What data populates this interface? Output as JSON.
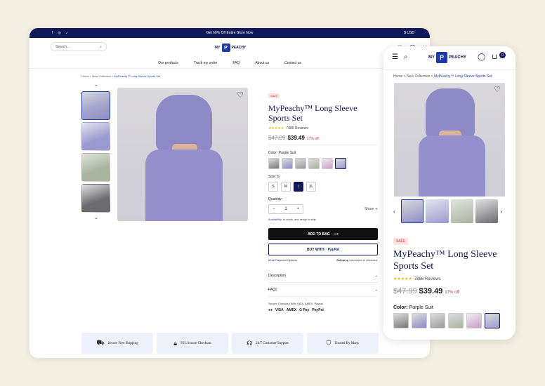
{
  "desktop": {
    "announcement": "Get 60% Off Entire Store Now",
    "currency": "$ USD",
    "socials": [
      "facebook-icon",
      "instagram-icon",
      "tiktok-icon"
    ],
    "search_placeholder": "Search...",
    "logo_left": "MY",
    "logo_mark": "P",
    "logo_right": "PEACHY",
    "nav": [
      "Our products",
      "Track my order",
      "FAQ",
      "About us",
      "Contact us"
    ],
    "breadcrumb": {
      "home": "Home",
      "sep": ">",
      "collection": "New Collection",
      "current": "MyPeachy™ Long Sleeve Sports Set"
    },
    "product": {
      "badge": "SALE",
      "title": "MyPeachy™ Long Sleeve Sports Set",
      "stars": "★★★★★",
      "reviews": "7886 Reviews",
      "old_price": "$47.99",
      "new_price": "$39.49",
      "discount": "17% off",
      "color_label": "Color: Purple Suit",
      "size_label": "Size: S",
      "sizes": [
        "S",
        "M",
        "L",
        "XL"
      ],
      "selected_size": "L",
      "qty_label": "Quantity:",
      "qty": "1",
      "minus": "−",
      "plus": "+",
      "share": "Share",
      "availability_label": "Availability:",
      "availability": "In stock, and ready to ship",
      "add_to_bag": "ADD TO BAG",
      "buy_with": "BUY WITH",
      "paypal": "PayPal",
      "more_payment": "More Payment Options",
      "shipping_bold": "Shipping",
      "shipping_rest": "calculated at checkout.",
      "accordion": [
        "Description",
        "FAQs"
      ],
      "secure_text": "Secure Checkout With VISA, AMEX, Paypal",
      "cards": [
        "VISA",
        "AMEX",
        "G Pay",
        "PayPal"
      ]
    },
    "features": [
      {
        "icon": "truck-icon",
        "label": "Secure Free Shipping"
      },
      {
        "icon": "lock-icon",
        "label": "SSL Secure Checkout"
      },
      {
        "icon": "headset-icon",
        "label": "24/7 Customer Support"
      },
      {
        "icon": "shield-icon",
        "label": "Trusted By Many"
      }
    ]
  },
  "mobile": {
    "logo_left": "MY",
    "logo_mark": "P",
    "logo_right": "PEACHY",
    "cart_count": "0",
    "breadcrumb": {
      "home": "Home",
      "sep": ">",
      "collection": "New Collection",
      "current": "MyPeachy™ Long Sleeve Sports Set"
    },
    "badge": "SALE",
    "title": "MyPeachy™ Long Sleeve Sports Set",
    "stars": "★★★★★",
    "reviews": "7886 Reviews",
    "old_price": "$47.99",
    "new_price": "$39.49",
    "discount": "17% off",
    "color_label": "Color:",
    "color_value": "Purple Suit"
  },
  "colors": {
    "navy": "#101858",
    "accent": "#1e3aa8",
    "sale": "#c0392b",
    "background": "#f3efe2"
  }
}
